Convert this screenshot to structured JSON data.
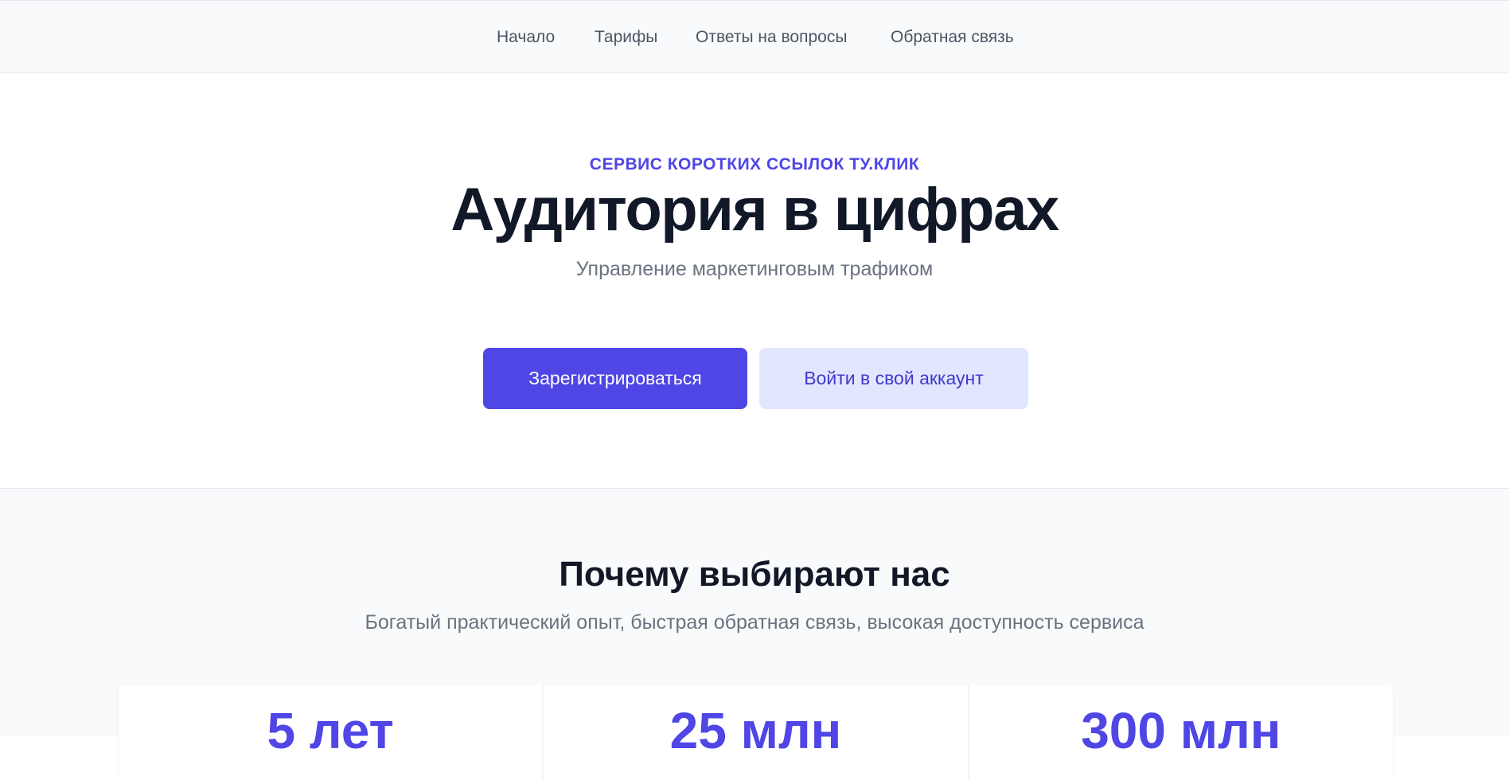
{
  "nav": {
    "items": [
      {
        "label": "Начало"
      },
      {
        "label": "Тарифы"
      },
      {
        "label": "Ответы на вопросы"
      },
      {
        "label": "Обратная связь"
      }
    ]
  },
  "hero": {
    "eyebrow": "СЕРВИС КОРОТКИХ ССЫЛОК ТУ.КЛИК",
    "title": "Аудитория в цифрах",
    "subtitle": "Управление маркетинговым трафиком",
    "primary_button": "Зарегистрироваться",
    "secondary_button": "Войти в свой аккаунт"
  },
  "why": {
    "title": "Почему выбирают нас",
    "subtitle": "Богатый практический опыт, быстрая обратная связь, высокая доступность сервиса",
    "stats": [
      {
        "value": "5 лет"
      },
      {
        "value": "25 млн"
      },
      {
        "value": "300 млн"
      }
    ]
  },
  "colors": {
    "accent": "#4f46e5",
    "accent_light": "#e0e7ff",
    "heading": "#111827",
    "muted_text": "#6b7280",
    "nav_background": "#f9fafb"
  }
}
